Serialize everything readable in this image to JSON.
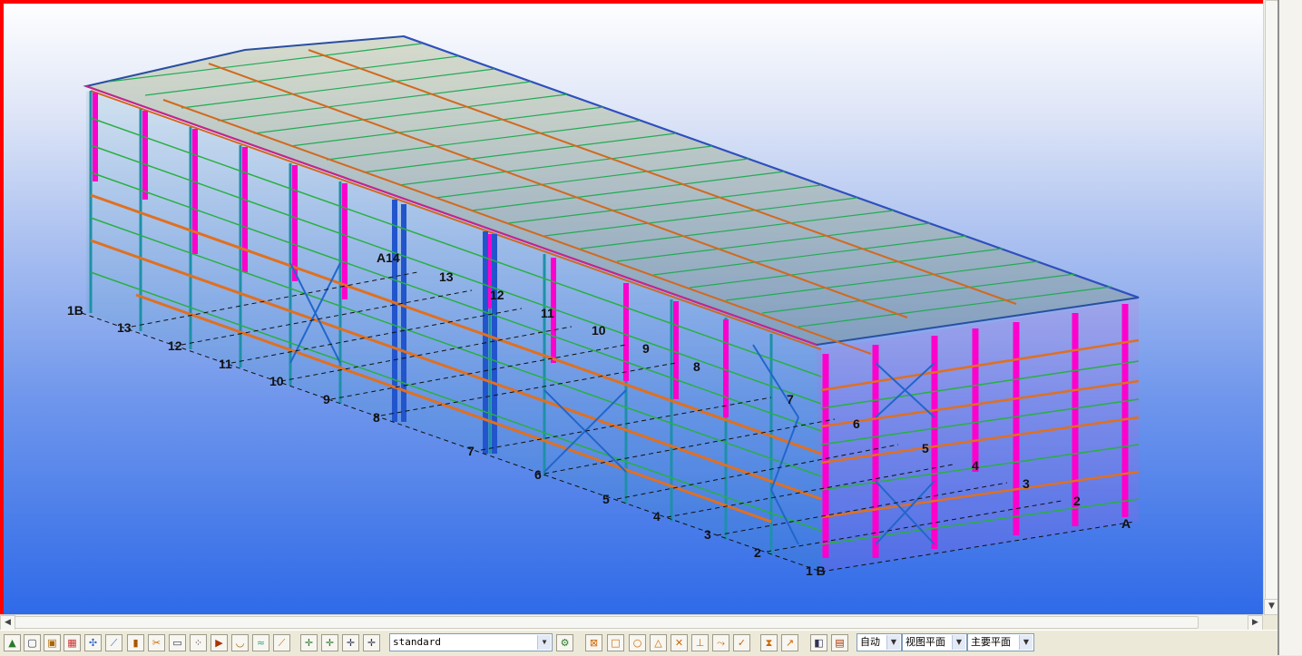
{
  "viewport": {
    "name": "3d-model-view",
    "grid_labels": [
      "1B",
      "14",
      "13",
      "12",
      "11",
      "10",
      "9",
      "8",
      "7",
      "6",
      "5",
      "4",
      "3",
      "2",
      "1 B",
      "A",
      "A14"
    ]
  },
  "toolbar": {
    "left_buttons": [
      "select-assembly",
      "select-part",
      "select-component",
      "select-grid",
      "select-point",
      "select-line",
      "select-weld",
      "select-cut",
      "select-plane",
      "select-reference",
      "select-bolt",
      "select-surface",
      "select-rebar",
      "snap-point",
      "snap-end",
      "snap-mid",
      "snap-line"
    ],
    "filter_combo": "standard",
    "snap_buttons": [
      "snap-nearest",
      "snap-square",
      "snap-circle",
      "snap-triangle",
      "snap-cross",
      "snap-perp",
      "snap-ext",
      "snap-check",
      "snap-hourglass",
      "snap-arrow",
      "view-render",
      "view-filter"
    ],
    "auto_select": "自动",
    "plane_select": "视图平面",
    "main_plane_select": "主要平面"
  }
}
